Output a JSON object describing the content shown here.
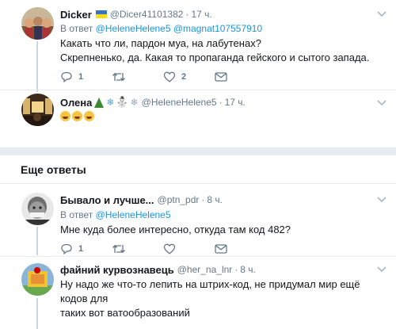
{
  "tweets": [
    {
      "name": "Dicker",
      "flag": "🇺🇦",
      "handle": "@Dicer41101382",
      "dot": "·",
      "time": "17 ч.",
      "reply_prefix": "В ответ",
      "reply_users": [
        "@HeleneHelene5",
        "@magnat107557910"
      ],
      "lines": [
        "Какать что ли, пардон муа, на лабутенах?",
        "Скрепненько, да. Какая то пропаганда гейского и сытого запада."
      ],
      "reply_count": "1",
      "retweet_count": "",
      "like_count": "2"
    },
    {
      "name": "Олена",
      "emoji": "🎄❄⛄❄",
      "handle": "@HeleneHelene5",
      "dot": "·",
      "time": "17 ч.",
      "lines": [
        "😂😂😂"
      ]
    },
    {
      "name": "Бывало и лучше...",
      "handle": "@ptn_pdr",
      "dot": "·",
      "time": "8 ч.",
      "reply_prefix": "В ответ",
      "reply_users": [
        "@HeleneHelene5"
      ],
      "lines": [
        "Мне куда более интересно, откуда там код 482?"
      ],
      "reply_count": "1",
      "retweet_count": "",
      "like_count": ""
    },
    {
      "name": "файний курвознавець",
      "handle": "@her_na_lnr",
      "dot": "·",
      "time": "8 ч.",
      "lines": [
        "Ну надо же что-то лепить на штрих-код, не придумал мир ещё кодов для",
        "таких вот ватообразований"
      ]
    }
  ],
  "section_title": "Еще ответы",
  "colors": {
    "accent": "#1b95e0",
    "muted": "#657786",
    "text": "#14171a",
    "border": "#e6ecf0"
  }
}
